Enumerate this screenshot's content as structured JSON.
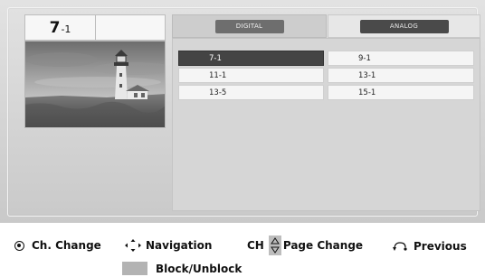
{
  "channel": {
    "major": "7",
    "minor": "-1"
  },
  "tabs": [
    {
      "label": "DIGITAL",
      "active": true
    },
    {
      "label": "ANALOG",
      "active": false
    }
  ],
  "channel_list": [
    {
      "label": "7-1",
      "selected": true
    },
    {
      "label": "9-1",
      "selected": false
    },
    {
      "label": "11-1",
      "selected": false
    },
    {
      "label": "13-1",
      "selected": false
    },
    {
      "label": "13-5",
      "selected": false
    },
    {
      "label": "15-1",
      "selected": false
    }
  ],
  "legend": {
    "ch_change": "Ch. Change",
    "navigation": "Navigation",
    "ch": "CH",
    "page_change": "Page Change",
    "previous": "Previous",
    "block_unblock": "Block/Unblock"
  },
  "colors": {
    "selected_row": "#444444",
    "block_swatch": "#b3b3b3"
  },
  "icons": {
    "ok": "ok-button-icon",
    "navigation": "navigation-arrows-icon",
    "page": "page-up-down-icon",
    "previous": "back-return-icon"
  }
}
